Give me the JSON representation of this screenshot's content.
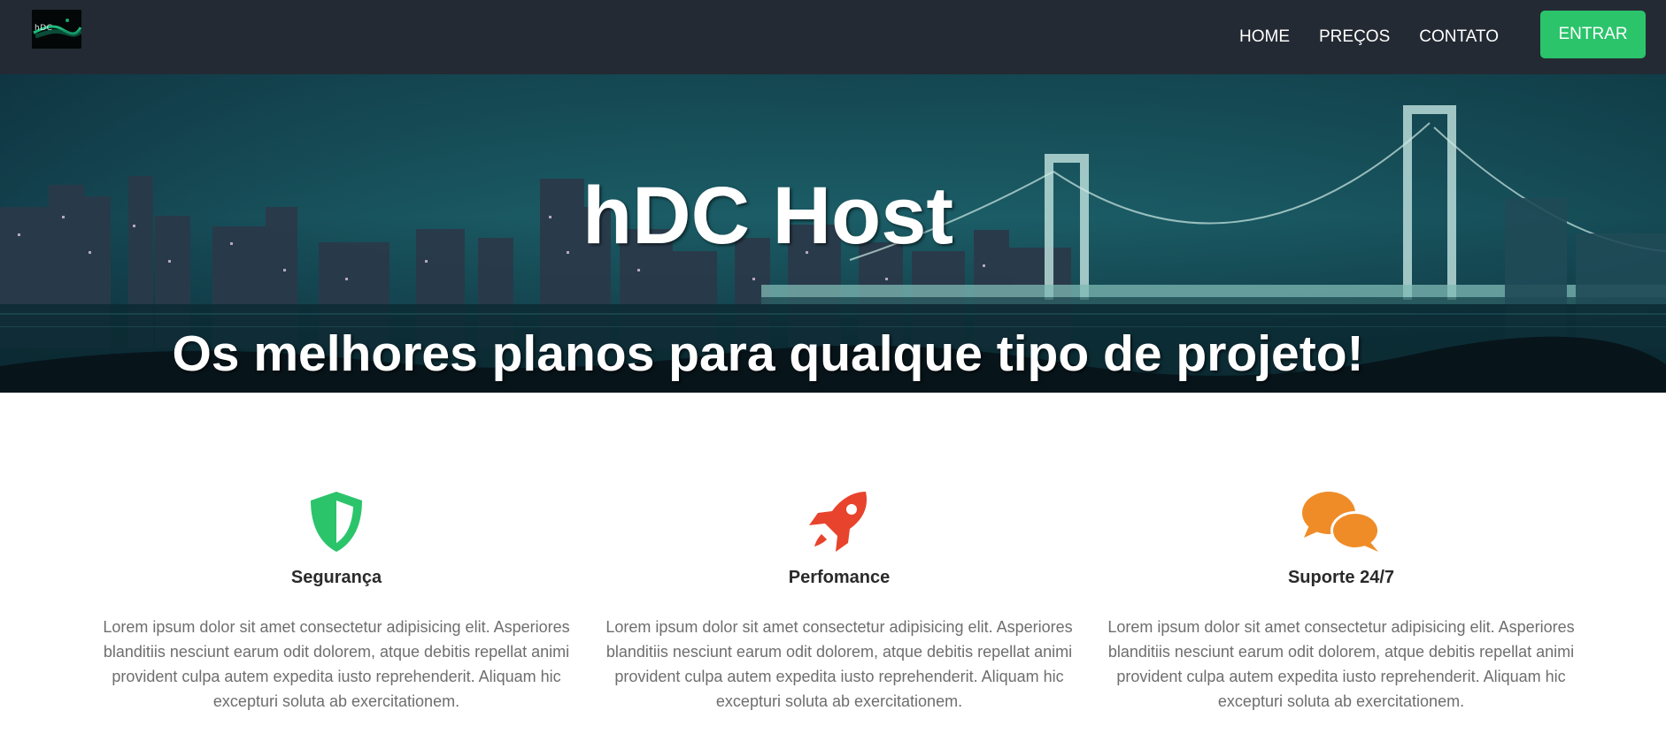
{
  "navbar": {
    "logo_text": "hDC",
    "links": [
      {
        "label": "HOME"
      },
      {
        "label": "PREÇOS"
      },
      {
        "label": "CONTATO"
      }
    ],
    "cta_label": "ENTRAR",
    "colors": {
      "background": "#242a33",
      "cta": "#2bc46b"
    }
  },
  "hero": {
    "title": "hDC Host",
    "subtitle": "Os melhores planos para qualque tipo de projeto!"
  },
  "features": [
    {
      "icon": "shield-icon",
      "title": "Segurança",
      "text": "Lorem ipsum dolor sit amet consectetur adipisicing elit. Asperiores blanditiis nesciunt earum odit dolorem, atque debitis repellat animi provident culpa autem expedita iusto reprehenderit. Aliquam hic excepturi soluta ab exercitationem.",
      "color": "#2bc46b"
    },
    {
      "icon": "rocket-icon",
      "title": "Perfomance",
      "text": "Lorem ipsum dolor sit amet consectetur adipisicing elit. Asperiores blanditiis nesciunt earum odit dolorem, atque debitis repellat animi provident culpa autem expedita iusto reprehenderit. Aliquam hic excepturi soluta ab exercitationem.",
      "color": "#e8432c"
    },
    {
      "icon": "chat-bubbles-icon",
      "title": "Suporte 24/7",
      "text": "Lorem ipsum dolor sit amet consectetur adipisicing elit. Asperiores blanditiis nesciunt earum odit dolorem, atque debitis repellat animi provident culpa autem expedita iusto reprehenderit. Aliquam hic excepturi soluta ab exercitationem.",
      "color": "#ef8c28"
    }
  ]
}
